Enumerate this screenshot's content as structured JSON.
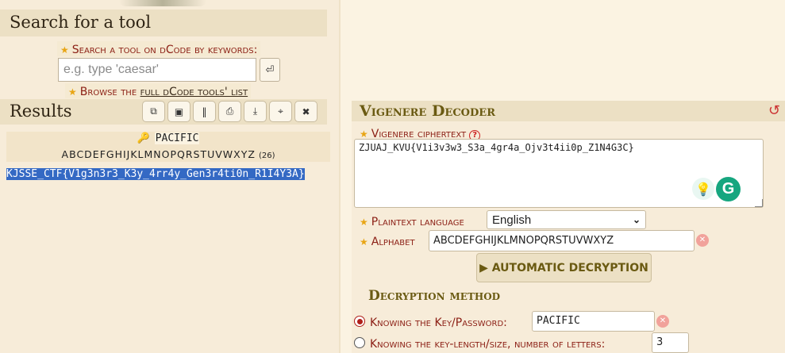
{
  "search": {
    "title": "Search for a tool",
    "label": "Search a tool on dCode by keywords:",
    "placeholder": "e.g. type 'caesar'",
    "go_icon": "⏎",
    "browse_prefix": "Browse the ",
    "browse_link": "full dCode tools' list"
  },
  "results": {
    "title": "Results",
    "toolbar": [
      {
        "name": "copy-icon",
        "glyph": "⧉"
      },
      {
        "name": "screenshot-icon",
        "glyph": "▣"
      },
      {
        "name": "columns-icon",
        "glyph": "‖"
      },
      {
        "name": "print-icon",
        "glyph": "⎙"
      },
      {
        "name": "download-icon",
        "glyph": "⤓"
      },
      {
        "name": "pin-icon",
        "glyph": "⌖"
      },
      {
        "name": "close-icon",
        "glyph": "✖"
      }
    ],
    "key_icon": "🔑",
    "key": "PACIFIC",
    "alphabet": "ABCDEFGHIJKLMNOPQRSTUVWXYZ",
    "alphabet_count": "(26)",
    "plaintext": "KJSSE_CTF{V1g3n3r3_K3y_4rr4y_Gen3r4ti0n_R1I4Y3A}"
  },
  "decoder": {
    "title": "Vigenere Decoder",
    "refresh_icon": "↺",
    "cipher_label": "Vigenere ciphertext",
    "help_glyph": "?",
    "ciphertext": "ZJUAJ_KVU{V1i3v3w3_S3a_4gr4a_Ojv3t4ii0p_Z1N4G3C}",
    "lang_label": "Plaintext language",
    "language": "English",
    "alphabet_label": "Alphabet",
    "alphabet": "ABCDEFGHIJKLMNOPQRSTUVWXYZ",
    "auto_button": "▶ AUTOMATIC DECRYPTION",
    "method_title": "Decryption method",
    "key_option_label": "Knowing the Key/Password:",
    "key_value": "PACIFIC",
    "length_option_label": "Knowing the key-length/size, number of letters:",
    "length_value": "3",
    "clear_glyph": "✕"
  },
  "colors": {
    "accent_red": "#8b1e14",
    "olive_heading": "#6a5a12",
    "selection_blue": "#3469c4",
    "grammarly_green": "#16a67f"
  }
}
